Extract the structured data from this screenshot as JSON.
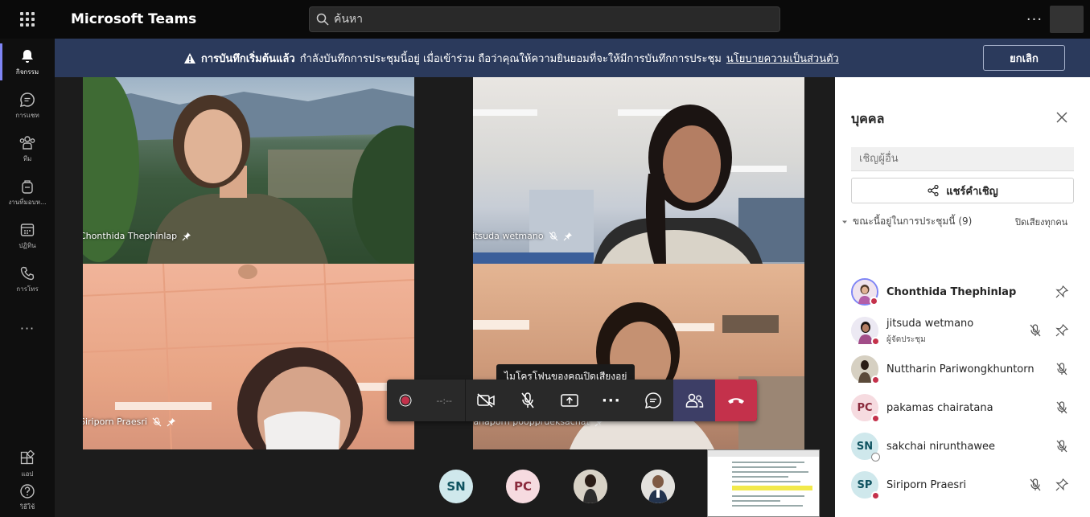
{
  "app": {
    "title": "Microsoft Teams"
  },
  "search": {
    "placeholder": "ค้นหา"
  },
  "rail": {
    "items": [
      {
        "label": "กิจกรรม",
        "icon": "bell-icon"
      },
      {
        "label": "การแชท",
        "icon": "chat-icon"
      },
      {
        "label": "ทีม",
        "icon": "teams-icon"
      },
      {
        "label": "งานที่มอบห...",
        "icon": "assignments-icon"
      },
      {
        "label": "ปฏิทิน",
        "icon": "calendar-icon"
      },
      {
        "label": "การโทร",
        "icon": "phone-icon"
      },
      {
        "label": "แอป",
        "icon": "apps-icon"
      },
      {
        "label": "วิธีใช้",
        "icon": "help-icon"
      }
    ]
  },
  "banner": {
    "bold": "การบันทึกเริ่มต้นแล้ว",
    "text": "กำลังบันทึกการประชุมนี้อยู่ เมื่อเข้าร่วม ถือว่าคุณให้ความยินยอมที่จะให้มีการบันทึกการประชุม",
    "link": "นโยบายความเป็นส่วนตัว",
    "cancel": "ยกเลิก"
  },
  "tiles": [
    {
      "name": "Chonthida Thephinlap"
    },
    {
      "name": "jitsuda wetmano"
    },
    {
      "name": "Siriporn Praesri"
    },
    {
      "name": "tanaporn poopprueksachat"
    }
  ],
  "controls": {
    "timer": "--:--",
    "tooltip": "ไมโครโฟนของคุณปิดเสียงอยู่"
  },
  "strip": {
    "avatars": [
      {
        "initials": "SN",
        "bg": "#cfe8ec",
        "fg": "#0f5360"
      },
      {
        "initials": "PC",
        "bg": "#f6dbe0",
        "fg": "#8a2a3c"
      }
    ]
  },
  "panel": {
    "title": "บุคคล",
    "invite_placeholder": "เชิญผู้อื่น",
    "share_invite": "แชร์คำเชิญ",
    "in_meeting": "ขณะนี้อยู่ในการประชุมนี้ (9)",
    "mute_all": "ปิดเสียงทุกคน",
    "participants": [
      {
        "name": "Chonthida Thephinlap",
        "role": ""
      },
      {
        "name": "jitsuda wetmano",
        "role": "ผู้จัดประชุม"
      },
      {
        "name": "Nuttharin Pariwongkhuntorn",
        "role": ""
      },
      {
        "name": "pakamas chairatana",
        "role": "",
        "initials": "PC"
      },
      {
        "name": "sakchai nirunthawee",
        "role": "",
        "initials": "SN"
      },
      {
        "name": "Siriporn Praesri",
        "role": "",
        "initials": "SP"
      }
    ]
  },
  "colors": {
    "accent": "#7f85f5",
    "hangup": "#c4314b",
    "banner": "#2b3a5c"
  }
}
